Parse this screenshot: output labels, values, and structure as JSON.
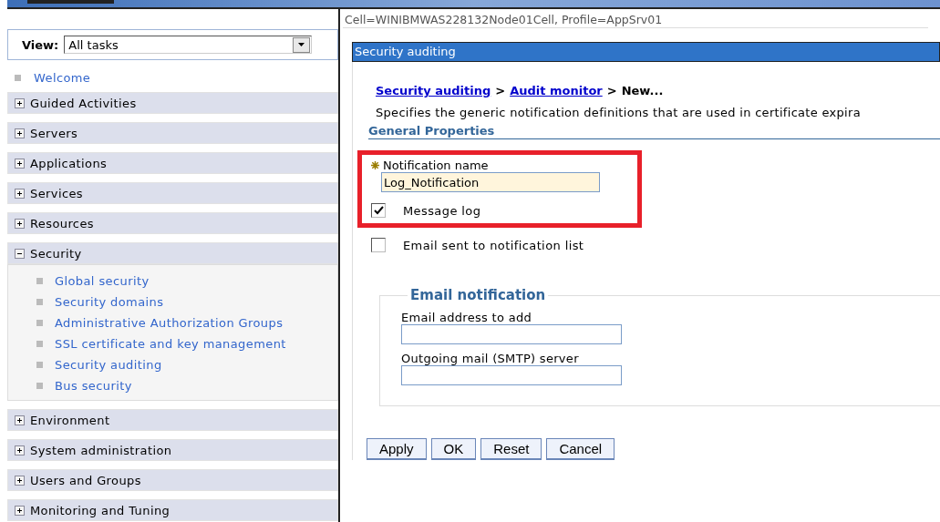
{
  "view": {
    "label": "View:",
    "value": "All tasks"
  },
  "nav": [
    {
      "kind": "link",
      "label": "Welcome"
    },
    {
      "kind": "section",
      "label": "Guided Activities",
      "expanded": false
    },
    {
      "kind": "section",
      "label": "Servers",
      "expanded": false
    },
    {
      "kind": "section",
      "label": "Applications",
      "expanded": false
    },
    {
      "kind": "section",
      "label": "Services",
      "expanded": false
    },
    {
      "kind": "section",
      "label": "Resources",
      "expanded": false
    },
    {
      "kind": "section",
      "label": "Security",
      "expanded": true,
      "children": [
        "Global security",
        "Security domains",
        "Administrative Authorization Groups",
        "SSL certificate and key management",
        "Security auditing",
        "Bus security"
      ]
    },
    {
      "kind": "section",
      "label": "Environment",
      "expanded": false
    },
    {
      "kind": "section",
      "label": "System administration",
      "expanded": false
    },
    {
      "kind": "section",
      "label": "Users and Groups",
      "expanded": false
    },
    {
      "kind": "section",
      "label": "Monitoring and Tuning",
      "expanded": false
    }
  ],
  "scope": "Cell=WINIBMWAS228132Node01Cell, Profile=AppSrv01",
  "panel_title": "Security auditing",
  "breadcrumb": {
    "separator": ">",
    "links": [
      "Security auditing",
      "Audit monitor"
    ],
    "current": "New..."
  },
  "description": "Specifies the generic notification definitions that are used in certificate expira",
  "section_title": "General Properties",
  "notification_name": {
    "label": "Notification name",
    "required": true,
    "value": "Log_Notification"
  },
  "options": [
    {
      "label": "Message log",
      "checked": true,
      "highlighted": true
    },
    {
      "label": "Email sent to notification list",
      "checked": false,
      "highlighted": false
    }
  ],
  "email": {
    "title": "Email notification",
    "fields": [
      {
        "label": "Email address to add"
      },
      {
        "label": "Outgoing mail (SMTP) server"
      }
    ]
  },
  "buttons": [
    "Apply",
    "OK",
    "Reset",
    "Cancel"
  ]
}
